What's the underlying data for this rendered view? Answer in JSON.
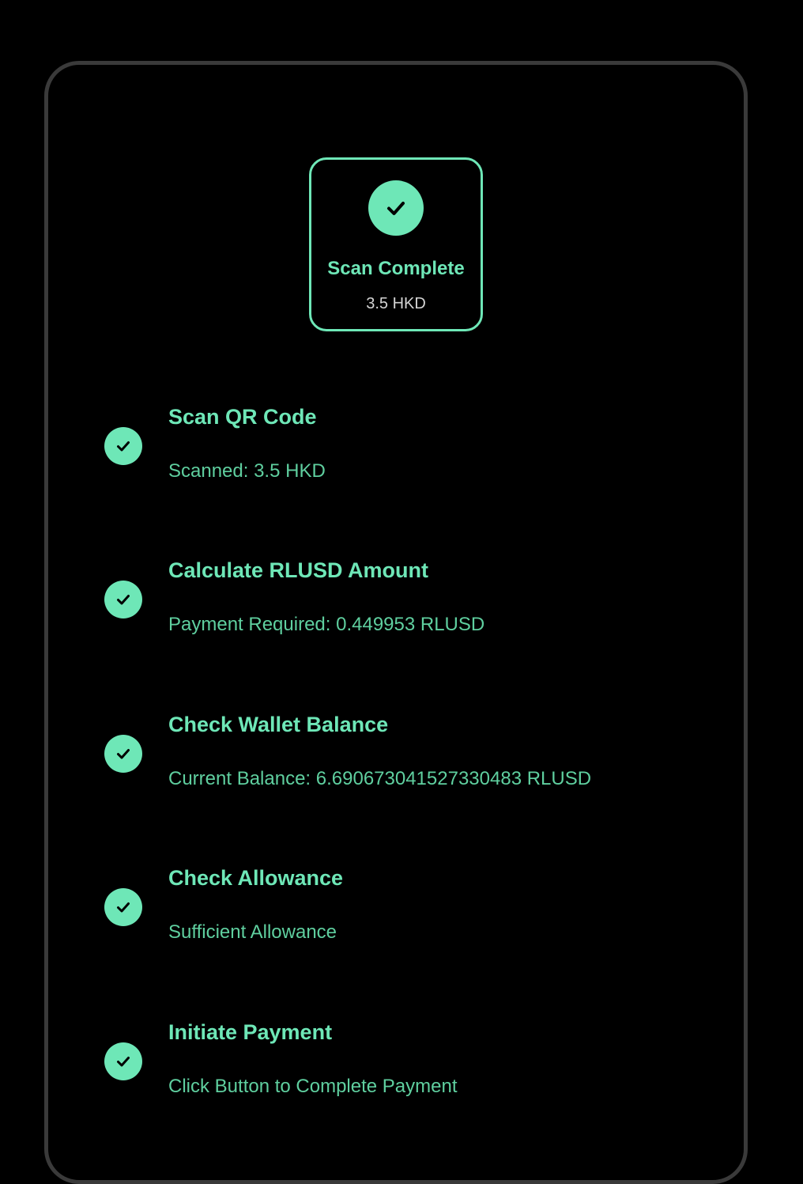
{
  "colors": {
    "background": "#000000",
    "frame_border": "#3a3a3a",
    "accent": "#6ee7b7",
    "detail_text": "#5fcf9f",
    "amount_text": "#d4d4d4"
  },
  "scan_card": {
    "icon": "check-circle-icon",
    "title": "Scan Complete",
    "amount": "3.5 HKD"
  },
  "steps": [
    {
      "icon": "check-circle-icon",
      "title": "Scan QR Code",
      "detail": "Scanned: 3.5 HKD",
      "status": "complete"
    },
    {
      "icon": "check-circle-icon",
      "title": "Calculate RLUSD Amount",
      "detail": "Payment Required: 0.449953 RLUSD",
      "status": "complete"
    },
    {
      "icon": "check-circle-icon",
      "title": "Check Wallet Balance",
      "detail": "Current Balance: 6.690673041527330483 RLUSD",
      "status": "complete"
    },
    {
      "icon": "check-circle-icon",
      "title": "Check Allowance",
      "detail": "Sufficient Allowance",
      "status": "complete"
    },
    {
      "icon": "check-circle-icon",
      "title": "Initiate Payment",
      "detail": "Click Button to Complete Payment",
      "status": "complete"
    }
  ]
}
